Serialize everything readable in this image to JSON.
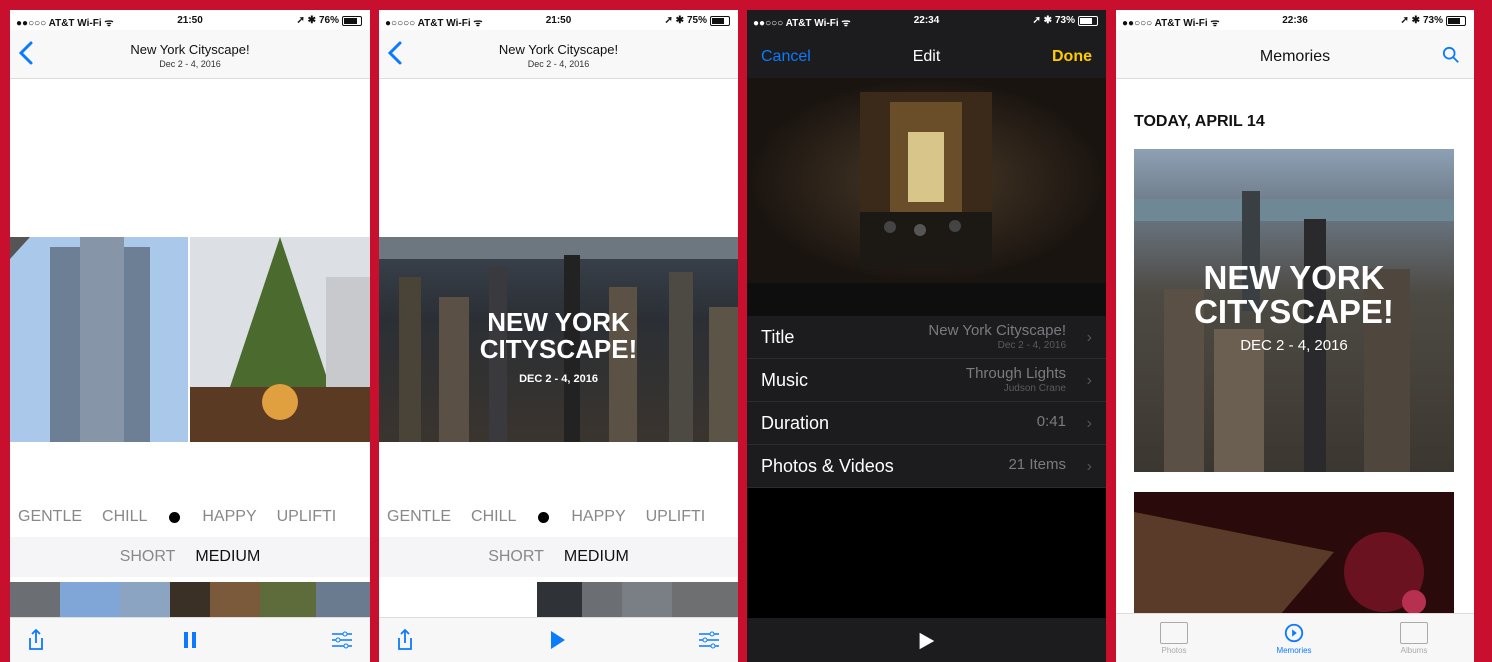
{
  "colors": {
    "frame": "#c8102e",
    "ios_blue": "#0a7aff",
    "done_yellow": "#ffcc00"
  },
  "phone1": {
    "status": {
      "carrier": "●●○○○ AT&T Wi-Fi ᯤ",
      "time": "21:50",
      "battery": "76%"
    },
    "nav": {
      "title": "New York Cityscape!",
      "subtitle": "Dec 2 - 4, 2016",
      "back_icon": "chevron-left-icon"
    },
    "moods": [
      "GENTLE",
      "CHILL",
      "HAPPY",
      "UPLIFTI"
    ],
    "lengths": {
      "short": "SHORT",
      "medium": "MEDIUM"
    },
    "toolbar": {
      "share_icon": "share-icon",
      "pause_icon": "pause-icon",
      "settings_icon": "sliders-icon"
    }
  },
  "phone2": {
    "status": {
      "carrier": "●○○○○ AT&T Wi-Fi ᯤ",
      "time": "21:50",
      "battery": "75%"
    },
    "nav": {
      "title": "New York Cityscape!",
      "subtitle": "Dec 2 - 4, 2016"
    },
    "cover": {
      "title_line1": "NEW YORK",
      "title_line2": "CITYSCAPE!",
      "date": "DEC 2 - 4, 2016"
    },
    "moods": [
      "GENTLE",
      "CHILL",
      "HAPPY",
      "UPLIFTI"
    ],
    "lengths": {
      "short": "SHORT",
      "medium": "MEDIUM"
    }
  },
  "phone3": {
    "status": {
      "carrier": "●●○○○ AT&T Wi-Fi ᯤ",
      "time": "22:34",
      "battery": "73%"
    },
    "nav": {
      "cancel": "Cancel",
      "title": "Edit",
      "done": "Done"
    },
    "rows": [
      {
        "label": "Title",
        "value": "New York Cityscape!",
        "sub": "Dec 2 - 4, 2016"
      },
      {
        "label": "Music",
        "value": "Through Lights",
        "sub": "Judson Crane"
      },
      {
        "label": "Duration",
        "value": "0:41",
        "sub": ""
      },
      {
        "label": "Photos & Videos",
        "value": "21 Items",
        "sub": ""
      }
    ]
  },
  "phone4": {
    "status": {
      "carrier": "●●○○○ AT&T Wi-Fi ᯤ",
      "time": "22:36",
      "battery": "73%"
    },
    "nav": {
      "title": "Memories"
    },
    "section": "TODAY, APRIL 14",
    "card": {
      "title_line1": "NEW YORK",
      "title_line2": "CITYSCAPE!",
      "date": "DEC 2 - 4, 2016"
    },
    "tabs": {
      "photos": "Photos",
      "memories": "Memories",
      "albums": "Albums"
    }
  }
}
